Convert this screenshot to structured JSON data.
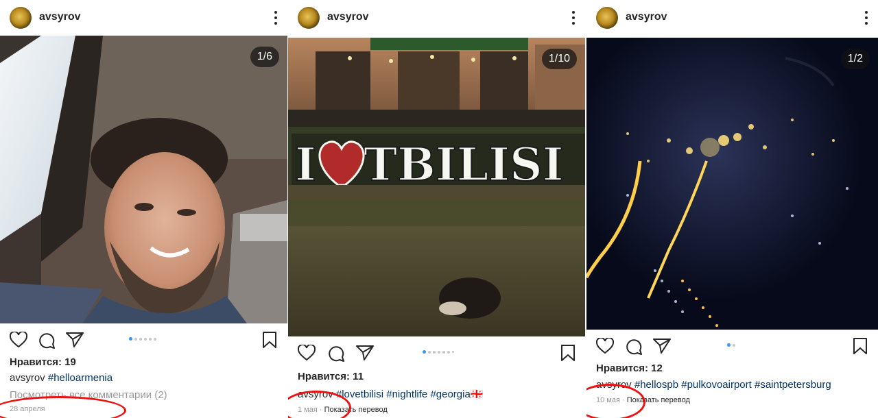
{
  "posts": [
    {
      "username": "avsyrov",
      "counter": "1/6",
      "likes": "Нравится: 19",
      "caption_user": "avsyrov",
      "caption_tags": "#helloarmenia",
      "comments": "Посмотреть все комментарии (2)",
      "date": "28 апреля",
      "show_translation": ""
    },
    {
      "username": "avsyrov",
      "counter": "1/10",
      "likes": "Нравится: 11",
      "caption_user": "avsyrov",
      "caption_tags": "#lovetbilisi #nightlife #georgia🇬🇪",
      "date": "1 мая",
      "separator": " · ",
      "show_translation": "Показать перевод",
      "sign_text": "I ♥ TBILISI"
    },
    {
      "username": "avsyrov",
      "counter": "1/2",
      "likes": "Нравится: 12",
      "caption_user": "avsyrov",
      "caption_tags": "#hellospb #pulkovoairport #saintpetersburg",
      "date": "10 мая",
      "separator": " · ",
      "show_translation": "Показать перевод"
    }
  ],
  "icons": [
    "heart-icon",
    "comment-icon",
    "share-icon",
    "bookmark-icon",
    "more-icon"
  ],
  "colors": {
    "highlight_oval": "#ee1111",
    "hashtag": "#003569",
    "active_dot": "#3897f0"
  }
}
